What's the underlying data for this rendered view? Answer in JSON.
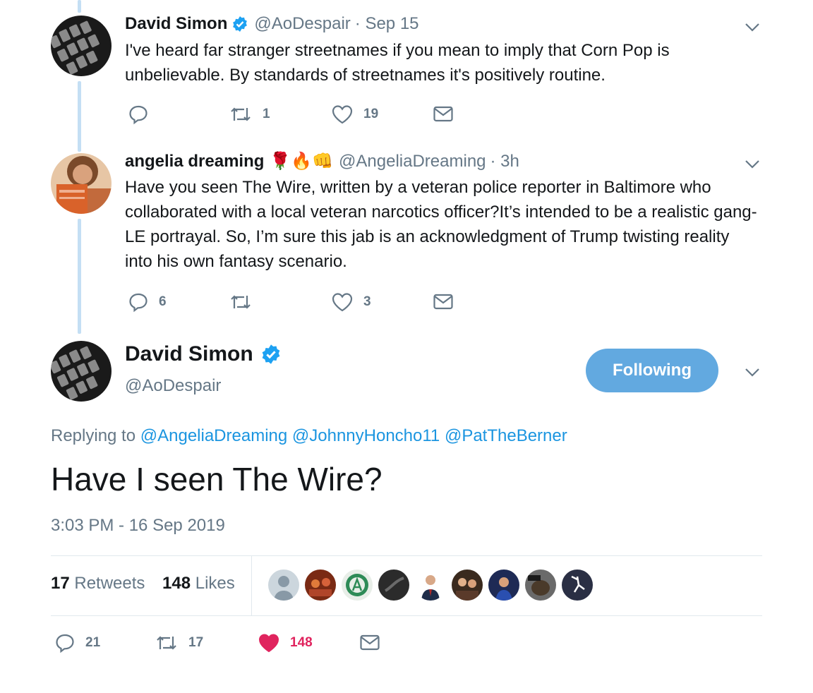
{
  "tweets": [
    {
      "name": "David Simon",
      "handle": "@AoDespair",
      "time": "· Sep 15",
      "text": "I've heard far stranger streetnames if you mean to imply that Corn Pop is unbelievable. By standards of streetnames it's positively routine.",
      "replies": "",
      "retweets": "1",
      "likes": "19"
    },
    {
      "name": "angelia dreaming",
      "name_emoji": "🌹🔥👊",
      "handle": "@AngeliaDreaming",
      "time": "· 3h",
      "text": "Have you seen The Wire, written by a veteran police reporter in Baltimore who collaborated with a local veteran narcotics officer?It’s intended to be a realistic gang-LE portrayal. So, I’m sure this jab is an acknowledgment of Trump twisting reality into his own fantasy scenario.",
      "replies": "6",
      "retweets": "",
      "likes": "3"
    }
  ],
  "main": {
    "name": "David Simon",
    "handle": "@AoDespair",
    "follow_label": "Following",
    "replying_prefix": "Replying to",
    "replying_to": [
      "@AngeliaDreaming",
      "@JohnnyHoncho11",
      "@PatTheBerner"
    ],
    "text": "Have I seen The Wire?",
    "timestamp": "3:03 PM - 16 Sep 2019",
    "retweet_count": "17",
    "retweet_label": "Retweets",
    "like_count": "148",
    "like_label": "Likes",
    "actions": {
      "replies": "21",
      "retweets": "17",
      "likes": "148"
    }
  },
  "colors": {
    "accent": "#1b95e0",
    "follow_button": "#62a9e0",
    "like_active": "#e0245e",
    "muted": "#657786",
    "thread_line": "#c4dff4"
  },
  "icons": [
    "reply-icon",
    "retweet-icon",
    "like-icon",
    "dm-icon",
    "chevron-down-icon",
    "verified-badge-icon"
  ]
}
